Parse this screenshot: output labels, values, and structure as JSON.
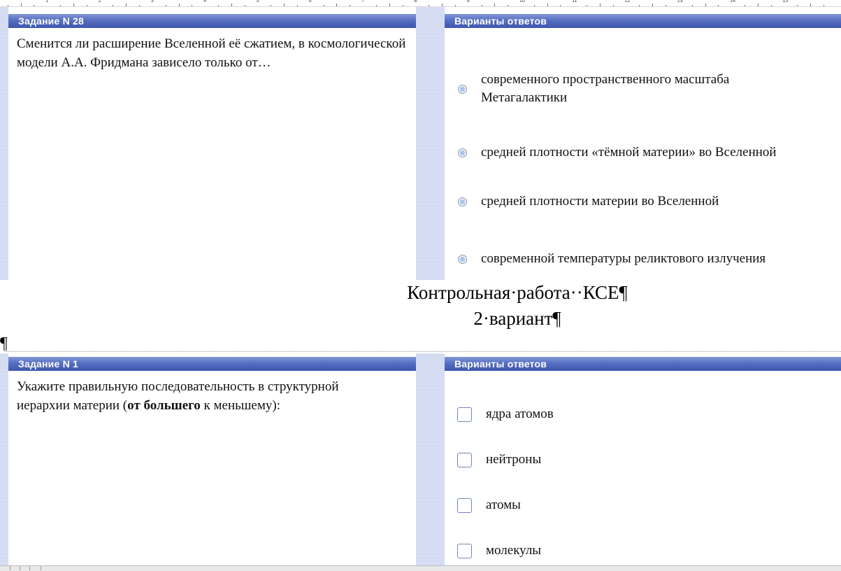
{
  "block1": {
    "question_header": "Задание N 28",
    "question_text": "Сменится ли расширение Вселенной её сжатием, в космологической модели А.А. Фридмана зависело только от…",
    "answers_header": "Варианты ответов",
    "options": [
      {
        "label": "современного пространственного масштаба Метагалактики"
      },
      {
        "label": "средней плотности «тёмной материи» во Вселенной"
      },
      {
        "label": "средней плотности материи во Вселенной"
      },
      {
        "label": "современной температуры реликтового излучения"
      }
    ]
  },
  "document": {
    "title_line1": "Контрольная·работа··КСЕ¶",
    "title_line2": "2·вариант¶",
    "pilcrow": "¶"
  },
  "block2": {
    "question_header": "Задание N 1",
    "question_text_before": "Укажите правильную последовательность в структурной иерархии материи (",
    "question_text_bold": "от большего",
    "question_text_after": " к меньшему):",
    "answers_header": "Варианты ответов",
    "options": [
      {
        "label": "ядра атомов"
      },
      {
        "label": "нейтроны"
      },
      {
        "label": "атомы"
      },
      {
        "label": "молекулы"
      }
    ]
  },
  "ruler": {
    "numbers": [
      "1",
      "2",
      "3",
      "4",
      "5",
      "6",
      "7",
      "8",
      "9",
      "10",
      "11",
      "12",
      "13",
      "14",
      "15"
    ]
  },
  "colors": {
    "header_gradient_top": "#8597d6",
    "header_gradient_bottom": "#3f56ad",
    "side_stripe": "#cbd3ee"
  }
}
